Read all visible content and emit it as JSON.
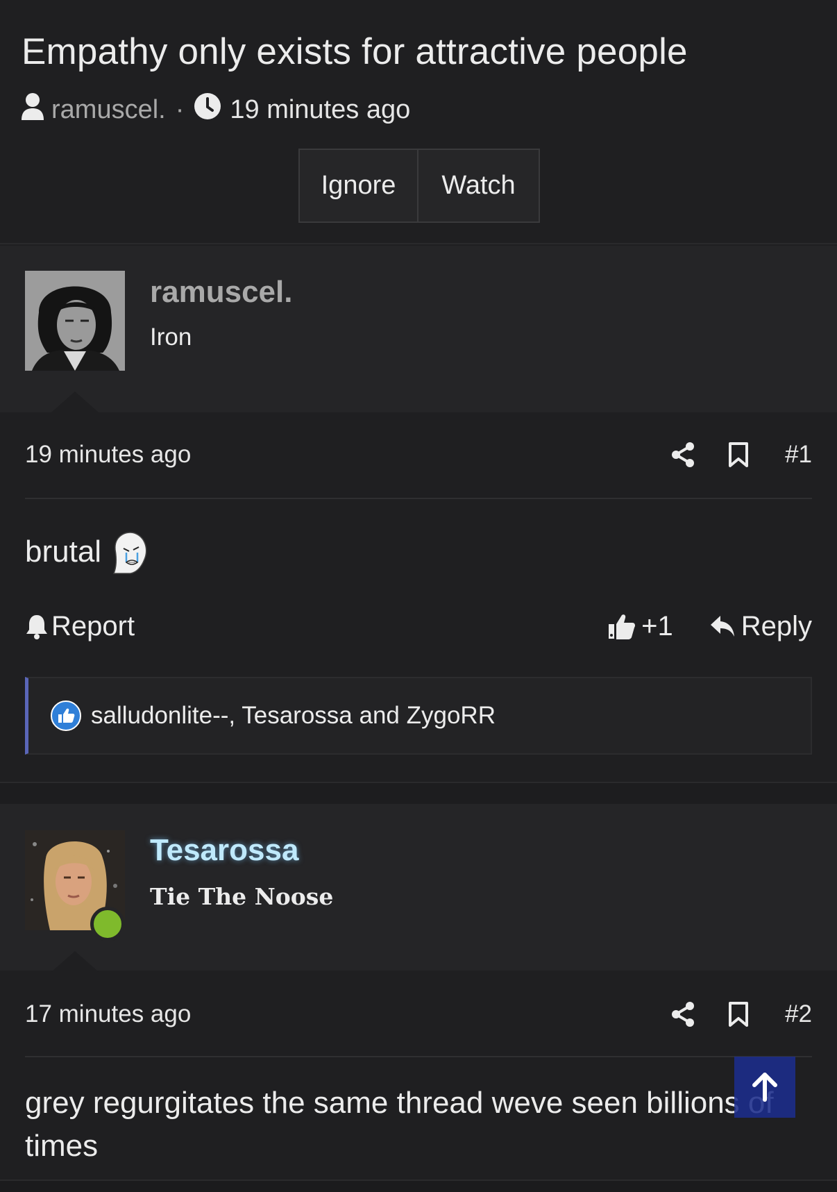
{
  "thread": {
    "title": "Empathy only exists for attractive people",
    "author": "ramuscel.",
    "separator": "·",
    "time": "19 minutes ago",
    "ignore_label": "Ignore",
    "watch_label": "Watch"
  },
  "posts": [
    {
      "username": "ramuscel.",
      "user_title": "Iron",
      "username_color": "#a9a9a9",
      "time": "19 minutes ago",
      "number": "#1",
      "message": "brutal",
      "report_label": "Report",
      "like_count": "+1",
      "reply_label": "Reply",
      "reactions_text": "salludonlite--, Tesarossa and ZygoRR"
    },
    {
      "username": "Tesarossa",
      "user_title": "Tie The Noose",
      "username_color": "#bfe9fb",
      "online_color": "#7fba2c",
      "time": "17 minutes ago",
      "number": "#2",
      "message": "grey regurgitates the same thread weve seen billions of times"
    }
  ],
  "colors": {
    "background": "#1f1f21",
    "panel": "#252527",
    "reaction_accent": "#5a66b8",
    "like_badge": "#2f7fd8",
    "scroll_top_button": "#1c2e8c"
  }
}
